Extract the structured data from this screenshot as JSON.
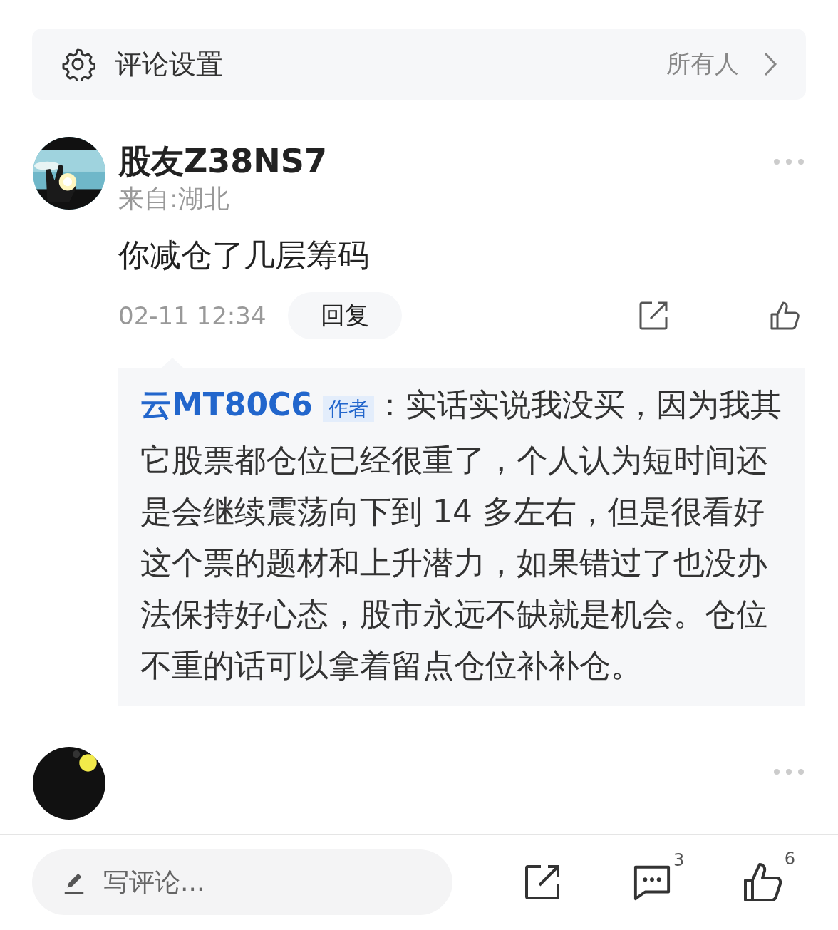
{
  "settings": {
    "label": "评论设置",
    "value": "所有人"
  },
  "comments": [
    {
      "kind": "full",
      "username": "股友Z38NS7",
      "location": "来自:湖北",
      "text": "你减仓了几层筹码",
      "time": "02-11 12:34",
      "reply_button": "回复",
      "replies": [
        {
          "author": "云MT80C6",
          "badge": "作者",
          "text": "：实话实说我没买，因为我其它股票都仓位已经很重了，个人认为短时间还是会继续震荡向下到 14 多左右，但是很看好这个票的题材和上升潜力，如果错过了也没办法保持好心态，股市永远不缺就是机会。仓位不重的话可以拿着留点仓位补补仓。"
        }
      ]
    },
    {
      "kind": "cut"
    }
  ],
  "bottom_bar": {
    "placeholder": "写评论...",
    "comment_count": "3",
    "like_count": "6"
  }
}
